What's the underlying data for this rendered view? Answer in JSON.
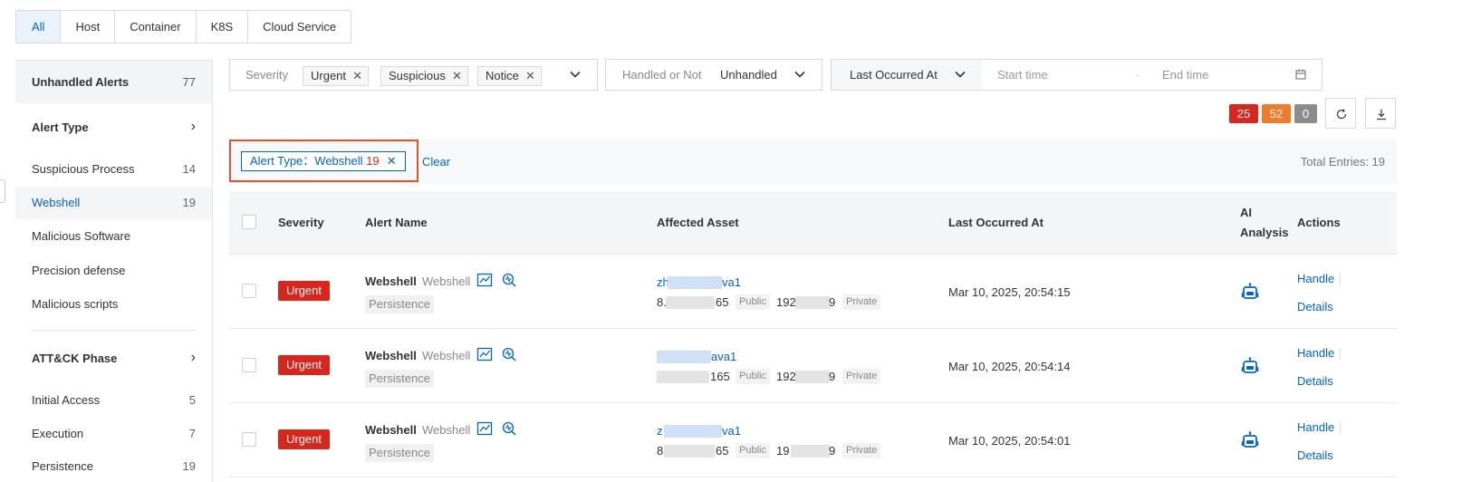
{
  "tabs": [
    "All",
    "Host",
    "Container",
    "K8S",
    "Cloud Service"
  ],
  "left_panel": {
    "unhandled_label": "Unhandled Alerts",
    "unhandled_count": "77",
    "alert_type_label": "Alert Type",
    "alert_types": [
      {
        "label": "Suspicious Process",
        "count": "14"
      },
      {
        "label": "Webshell",
        "count": "19"
      },
      {
        "label": "Malicious Software",
        "count": ""
      },
      {
        "label": "Precision defense",
        "count": ""
      },
      {
        "label": "Malicious scripts",
        "count": ""
      }
    ],
    "attck_label": "ATT&CK Phase",
    "attck_phases": [
      {
        "label": "Initial Access",
        "count": "5"
      },
      {
        "label": "Execution",
        "count": "7"
      },
      {
        "label": "Persistence",
        "count": "19"
      }
    ]
  },
  "filters": {
    "severity_label": "Severity",
    "severity_chips": [
      "Urgent",
      "Suspicious",
      "Notice"
    ],
    "handled_label": "Handled or Not",
    "handled_value": "Unhandled",
    "date_label": "Last Occurred At",
    "start_placeholder": "Start time",
    "end_placeholder": "End time",
    "date_separator": "-"
  },
  "counters": {
    "urgent": "25",
    "suspicious": "52",
    "notice": "0"
  },
  "active_filter": {
    "prefix": "Alert Type：Webshell",
    "count": "19",
    "clear_label": "Clear",
    "total_label": "Total Entries: 19"
  },
  "table": {
    "headers": {
      "severity": "Severity",
      "alert_name": "Alert Name",
      "affected_asset": "Affected Asset",
      "last_occurred": "Last Occurred At",
      "ai_analysis_line1": "AI",
      "ai_analysis_line2": "Analysis",
      "actions": "Actions"
    },
    "rows": [
      {
        "severity": "Urgent",
        "name": "Webshell",
        "type": "Webshell",
        "tag": "Persistence",
        "asset_prefix": "zh",
        "asset_suffix": "va1",
        "public_prefix": "8.",
        "public_suffix": "65",
        "public_tag": "Public",
        "private_prefix": "192",
        "private_suffix": "9",
        "private_tag": "Private",
        "time": "Mar 10, 2025, 20:54:15",
        "handle": "Handle",
        "details": "Details"
      },
      {
        "severity": "Urgent",
        "name": "Webshell",
        "type": "Webshell",
        "tag": "Persistence",
        "asset_prefix": "",
        "asset_suffix": "ava1",
        "public_prefix": "",
        "public_suffix": "165",
        "public_tag": "Public",
        "private_prefix": "192",
        "private_suffix": "9",
        "private_tag": "Private",
        "time": "Mar 10, 2025, 20:54:14",
        "handle": "Handle",
        "details": "Details"
      },
      {
        "severity": "Urgent",
        "name": "Webshell",
        "type": "Webshell",
        "tag": "Persistence",
        "asset_prefix": "z",
        "asset_suffix": "va1",
        "public_prefix": "8",
        "public_suffix": "65",
        "public_tag": "Public",
        "private_prefix": "19",
        "private_suffix": "9",
        "private_tag": "Private",
        "time": "Mar 10, 2025, 20:54:01",
        "handle": "Handle",
        "details": "Details"
      }
    ]
  },
  "colors": {
    "accent": "#0064c8",
    "urgent": "#d9261c",
    "suspicious": "#f07c2a",
    "notice": "#8c8c8c",
    "highlight_box": "#e5532b"
  },
  "icons": [
    "close-icon",
    "chevron-down-icon",
    "chevron-right-icon",
    "calendar-icon",
    "refresh-icon",
    "download-icon",
    "chart-icon",
    "investigate-icon",
    "ai-robot-icon"
  ]
}
